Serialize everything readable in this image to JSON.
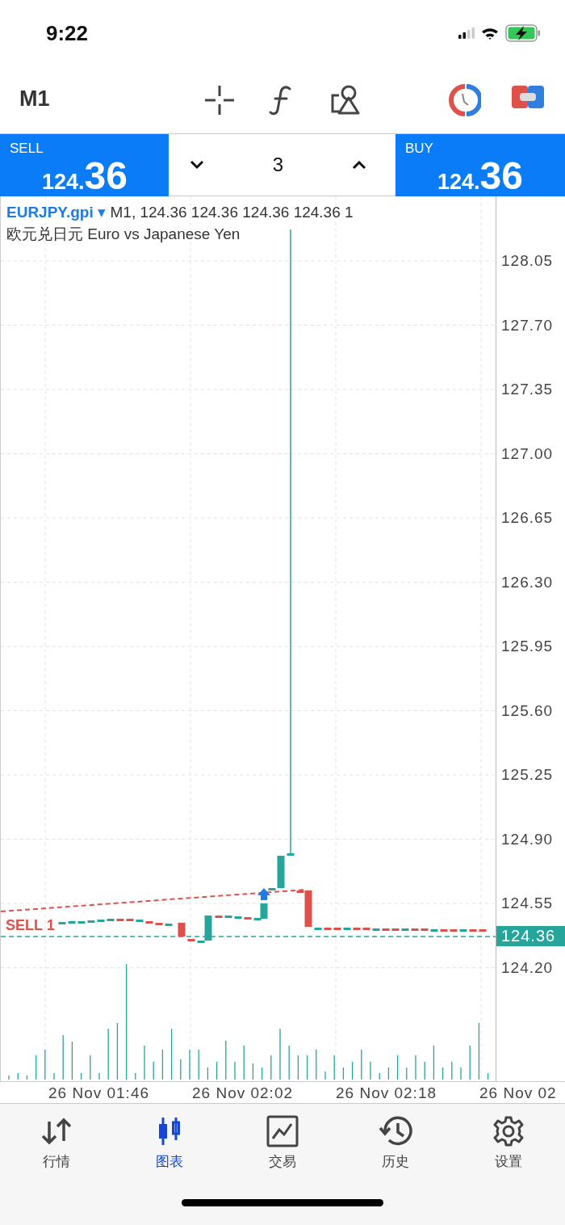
{
  "status_bar": {
    "time": "9:22"
  },
  "toolbar": {
    "timeframe": "M1"
  },
  "trade_panel": {
    "sell": {
      "label": "SELL",
      "price_small": "124.",
      "price_big": "36"
    },
    "volume": "3",
    "buy": {
      "label": "BUY",
      "price_small": "124.",
      "price_big": "36"
    }
  },
  "chart": {
    "symbol": "EURJPY.gpi",
    "symbol_caret": "▾",
    "quote": "M1, 124.36 124.36 124.36 124.36 1",
    "description": "欧元兑日元 Euro vs Japanese Yen",
    "order_line": "SELL 1",
    "price_labels": [
      "128.05",
      "127.70",
      "127.35",
      "127.00",
      "126.65",
      "126.30",
      "125.95",
      "125.60",
      "125.25",
      "124.90",
      "124.55",
      "124.20"
    ],
    "current_price": "124.36",
    "time_labels": [
      "26 Nov 01:46",
      "26 Nov 02:02",
      "26 Nov 02:18",
      "26 Nov 02"
    ]
  },
  "tabs": [
    {
      "kind": "quotes",
      "label": "行情",
      "selected": false
    },
    {
      "kind": "chart",
      "label": "图表",
      "selected": true
    },
    {
      "kind": "trade",
      "label": "交易",
      "selected": false
    },
    {
      "kind": "history",
      "label": "历史",
      "selected": false
    },
    {
      "kind": "settings",
      "label": "设置",
      "selected": false
    }
  ]
}
